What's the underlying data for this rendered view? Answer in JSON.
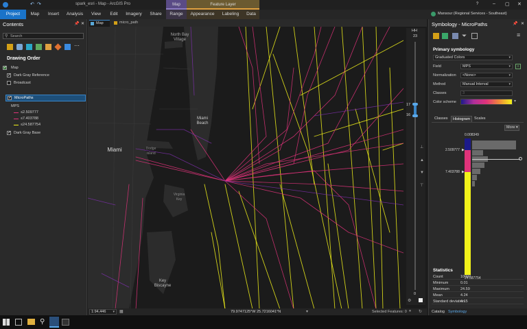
{
  "title_bar": {
    "title": "spark_esri - Map - ArcGIS Pro",
    "help": "?",
    "user": "Mansour (Regional Services - Southeast)"
  },
  "ribbon": {
    "tabs": [
      "Project",
      "Map",
      "Insert",
      "Analysis",
      "View",
      "Edit",
      "Imagery",
      "Share"
    ],
    "context_groups": [
      {
        "label": "Map",
        "tabs": [
          "Range"
        ]
      },
      {
        "label": "Feature Layer",
        "tabs": [
          "Appearance",
          "Labeling",
          "Data"
        ]
      }
    ]
  },
  "contents": {
    "title": "Contents",
    "search_placeholder": "Search",
    "drawing_order": "Drawing Order",
    "map_label": "Map",
    "layers": [
      {
        "name": "Dark Gray Reference",
        "checked": true
      },
      {
        "name": "Broadcast",
        "checked": false
      },
      {
        "name": "MicroPaths",
        "checked": true,
        "selected": true
      },
      {
        "name": "Dark Gray Base",
        "checked": true
      }
    ],
    "legend": {
      "field": "MPS",
      "classes": [
        {
          "label": "≤2.509777",
          "color": "#e0337a"
        },
        {
          "label": "≤7.403788",
          "color": "#e0337a"
        },
        {
          "label": "≤24.587754",
          "color": "#f2f21a"
        }
      ]
    }
  },
  "map_tabs": [
    {
      "label": "Map",
      "active": true
    },
    {
      "label": "micro_path",
      "active": false
    }
  ],
  "map_labels": [
    "North Bay\nVillage",
    "Miami\nBeach",
    "Miami",
    "Dodge\nIsland",
    "Virginia\nKey",
    "Key\nBiscayne"
  ],
  "time_slider": {
    "unit": "HH",
    "top": "23",
    "value_a": "17",
    "value_b": "16",
    "bottom": "0"
  },
  "status_bar": {
    "scale": "1:94,446",
    "coords": "79.9747125°W 25.7216041°N",
    "selected": "Selected Features: 0"
  },
  "symbology": {
    "title": "Symbology - MicroPaths",
    "section": "Primary symbology",
    "method_type": "Graduated Colors",
    "field_label": "Field",
    "field_value": "MPS",
    "normalization_label": "Normalization",
    "normalization_value": "<None>",
    "method_label": "Method",
    "method_value": "Manual Interval",
    "classes_label": "Classes",
    "classes_value": "3",
    "color_scheme_label": "Color scheme",
    "subtabs": [
      "Classes",
      "Histogram",
      "Scales"
    ],
    "more": "More",
    "histogram": {
      "min": "0.008349",
      "break1": "2.509777",
      "break2": "7.403788",
      "max": "24.587754",
      "class_colors": [
        "#1c1a8a",
        "#e0337a",
        "#f2f21a"
      ]
    },
    "statistics_title": "Statistics",
    "statistics": [
      {
        "k": "Count",
        "v": "10000"
      },
      {
        "k": "Minimum",
        "v": "0.01"
      },
      {
        "k": "Maximum",
        "v": "24.59"
      },
      {
        "k": "Mean",
        "v": "4.24"
      },
      {
        "k": "Standard deviation",
        "v": "4.15"
      }
    ],
    "bottom_tabs": [
      "Catalog",
      "Symbology"
    ]
  },
  "colors": {
    "accent": "#1a73c8",
    "track_yellow": "#f2f21a",
    "track_magenta": "#e0337a",
    "track_purple": "#7b2fa8"
  }
}
